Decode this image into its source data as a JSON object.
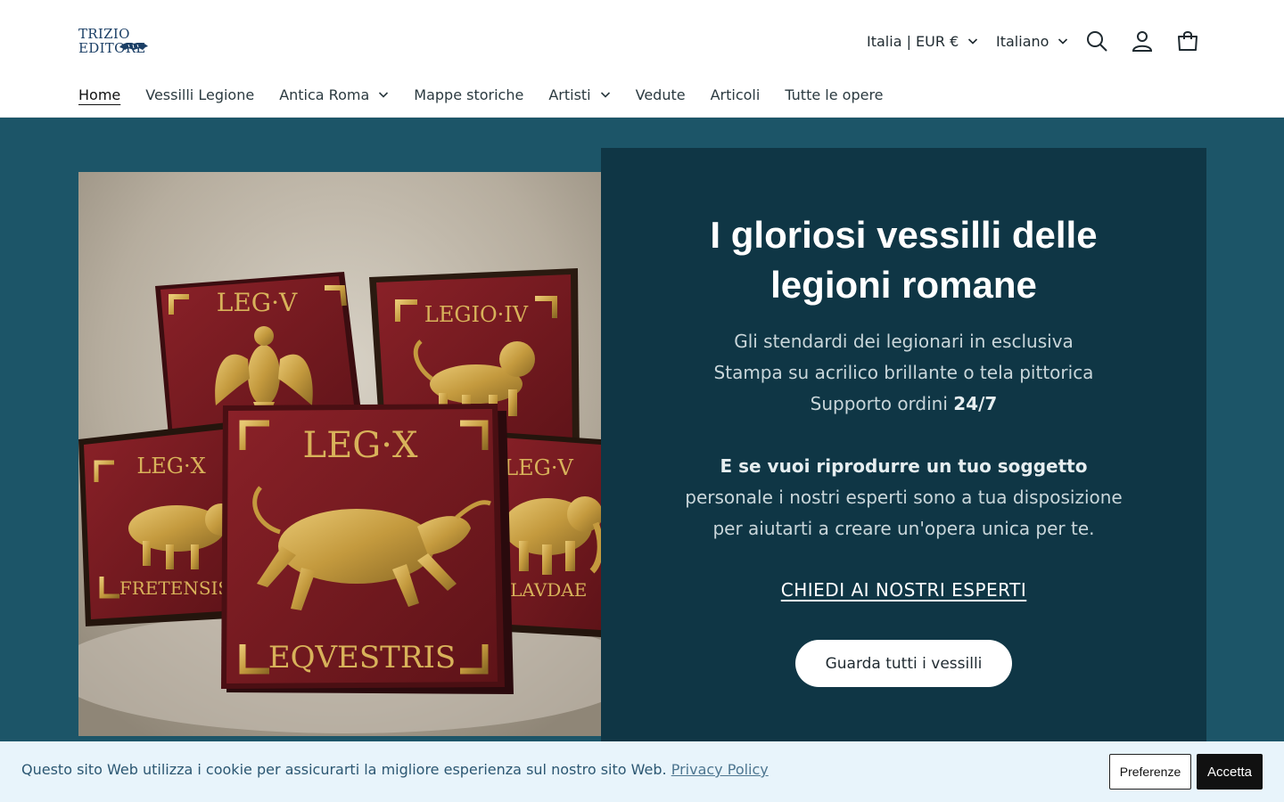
{
  "brand": {
    "logo_text": "TRIZIO EDITORE"
  },
  "header": {
    "locale_selector": "Italia | EUR €",
    "language_selector": "Italiano",
    "icons": [
      "search-icon",
      "account-icon",
      "cart-icon"
    ]
  },
  "nav": {
    "items": [
      {
        "label": "Home",
        "active": true,
        "dropdown": false
      },
      {
        "label": "Vessilli Legione",
        "active": false,
        "dropdown": false
      },
      {
        "label": "Antica Roma",
        "active": false,
        "dropdown": true
      },
      {
        "label": "Mappe storiche",
        "active": false,
        "dropdown": false
      },
      {
        "label": "Artisti",
        "active": false,
        "dropdown": true
      },
      {
        "label": "Vedute",
        "active": false,
        "dropdown": false
      },
      {
        "label": "Articoli",
        "active": false,
        "dropdown": false
      },
      {
        "label": "Tutte le opere",
        "active": false,
        "dropdown": false
      }
    ]
  },
  "hero": {
    "title_line1": "I gloriosi vessilli delle",
    "title_line2": "legioni romane",
    "line1": "Gli stendardi dei legionari in esclusiva",
    "line2": "Stampa su acrilico brillante o tela pittorica",
    "line3_prefix": "Supporto ordini ",
    "line3_bold": "24/7",
    "line4_bold": "E se vuoi riprodurre un tuo soggetto",
    "line5": "personale i nostri esperti sono a tua disposizione",
    "line6": "per aiutarti a creare un'opera unica per te.",
    "link_label": "CHIEDI AI NOSTRI ESPERTI",
    "button_label": "Guarda tutti i vessilli",
    "image": {
      "standards": [
        {
          "top": "LEG·V",
          "bottom": ""
        },
        {
          "top": "LEGIO·IV",
          "bottom": ""
        },
        {
          "top": "LEG·X",
          "bottom": "FRETENSIS"
        },
        {
          "top": "LEG·X",
          "bottom": "EQVESTRIS"
        },
        {
          "top": "LEG·V",
          "bottom": "ALAVDAE"
        }
      ]
    }
  },
  "cookie": {
    "text": "Questo sito Web utilizza i cookie per assicurarti la migliore esperienza sul nostro sito Web.",
    "link": "Privacy Policy",
    "preferences_label": "Preferenze",
    "accept_label": "Accetta"
  },
  "colors": {
    "hero_bg": "#1c5568",
    "panel_bg": "#0f3645",
    "cookie_bg": "#e8f4fb",
    "standard_red": "#7a1c22",
    "gold": "#c9a24a"
  }
}
